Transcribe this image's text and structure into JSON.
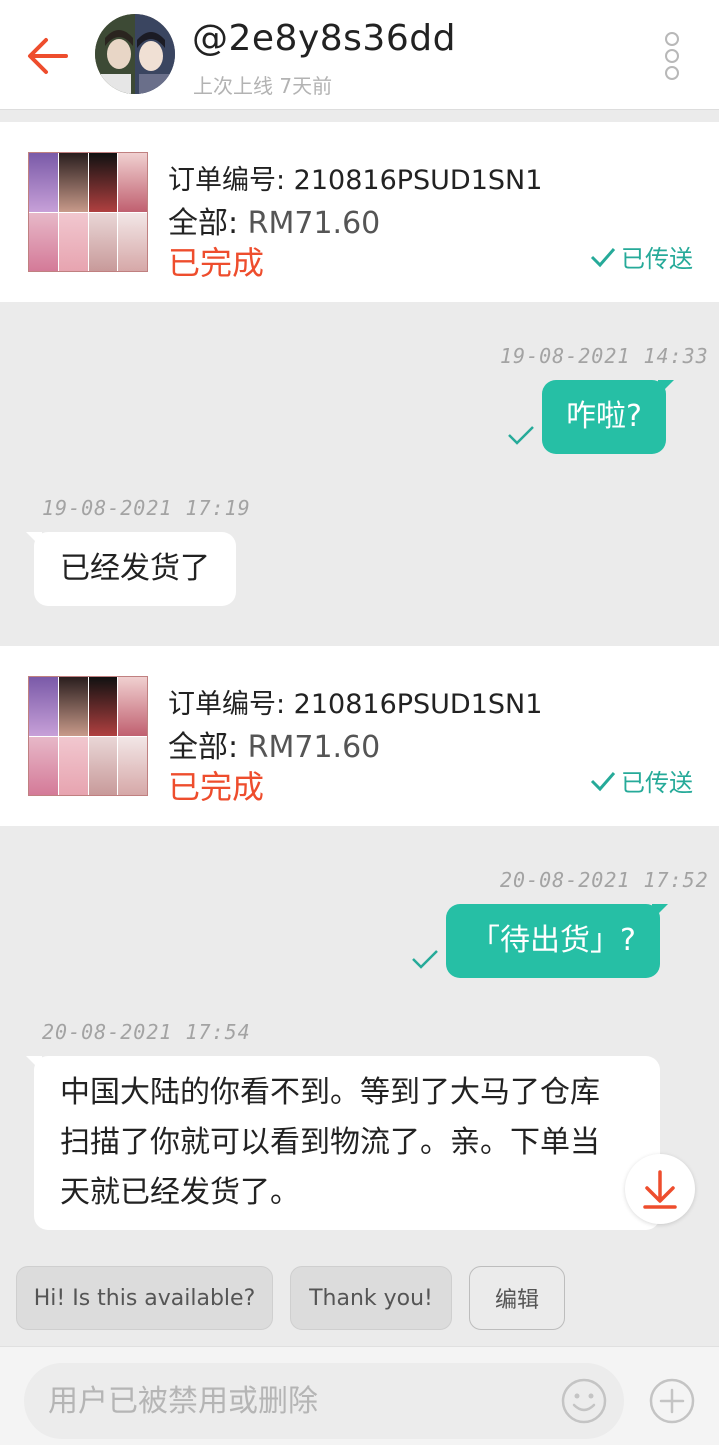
{
  "header": {
    "username": "@2e8y8s36dd",
    "last_online": "上次上线 7天前"
  },
  "orders": [
    {
      "number_label": "订单编号: 210816PSUD1SN1",
      "total_label": "全部:",
      "total_amount": " RM71.60",
      "status": "已完成",
      "sent_label": "已传送"
    },
    {
      "number_label": "订单编号: 210816PSUD1SN1",
      "total_label": "全部:",
      "total_amount": " RM71.60",
      "status": "已完成",
      "sent_label": "已传送"
    }
  ],
  "messages": [
    {
      "direction": "out",
      "timestamp": "19-08-2021 14:33",
      "text": "咋啦?"
    },
    {
      "direction": "in",
      "timestamp": "19-08-2021 17:19",
      "text": "已经发货了"
    },
    {
      "direction": "out",
      "timestamp": "20-08-2021 17:52",
      "text": "「待出货」?"
    },
    {
      "direction": "in",
      "timestamp": "20-08-2021 17:54",
      "text_lines": [
        "中国大陆的你看不到。等到了大马了仓库",
        "扫描了你就可以看到物流了。亲。下单当",
        "天就已经发货了。"
      ]
    }
  ],
  "quick_replies": [
    "Hi! Is this available?",
    "Thank you!",
    "编辑"
  ],
  "input": {
    "placeholder": "用户已被禁用或删除"
  },
  "colors": {
    "accent": "#ee4d2d",
    "bubble_out": "#26bfa5",
    "sent_check": "#26aa99"
  },
  "icons": [
    "back-arrow-icon",
    "more-vertical-icon",
    "check-icon",
    "download-arrow-icon",
    "emoji-icon",
    "plus-icon"
  ]
}
